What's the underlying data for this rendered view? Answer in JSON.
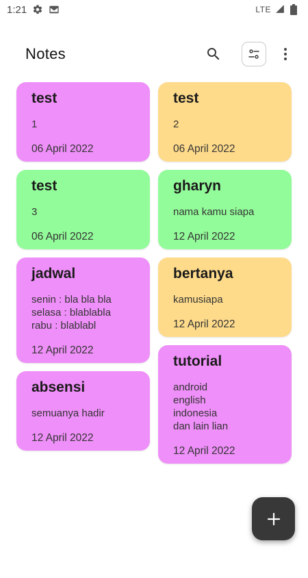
{
  "status_bar": {
    "time": "1:21",
    "network": "LTE",
    "icons": [
      "settings-icon",
      "gmail-icon",
      "signal-icon",
      "battery-icon"
    ]
  },
  "app_bar": {
    "title": "Notes",
    "actions": [
      "search-icon",
      "view-toggle-icon",
      "more-vert-icon"
    ]
  },
  "colors": {
    "purple": "#ef8ff9",
    "orange": "#fedb8b",
    "green": "#93fc9a",
    "fab": "#383838"
  },
  "notes": {
    "left": [
      {
        "title": "test",
        "body": "1",
        "date": "06 April 2022",
        "color": "#ef8ff9"
      },
      {
        "title": "test",
        "body": "3",
        "date": "06 April 2022",
        "color": "#93fc9a"
      },
      {
        "title": "jadwal",
        "body": "senin : bla bla bla\nselasa : blablabla\nrabu : blablabl",
        "date": "12 April 2022",
        "color": "#ef8ff9"
      },
      {
        "title": "absensi",
        "body": "semuanya hadir",
        "date": "12 April 2022",
        "color": "#ef8ff9"
      }
    ],
    "right": [
      {
        "title": "test",
        "body": "2",
        "date": "06 April 2022",
        "color": "#fedb8b"
      },
      {
        "title": "gharyn",
        "body": "nama kamu siapa",
        "date": "12 April 2022",
        "color": "#93fc9a"
      },
      {
        "title": "bertanya",
        "body": "kamusiapa",
        "date": "12 April 2022",
        "color": "#fedb8b"
      },
      {
        "title": "tutorial",
        "body": "android\nenglish\nindonesia\ndan lain lian",
        "date": "12 April 2022",
        "color": "#ef8ff9"
      }
    ]
  },
  "fab": {
    "icon": "add-icon"
  }
}
